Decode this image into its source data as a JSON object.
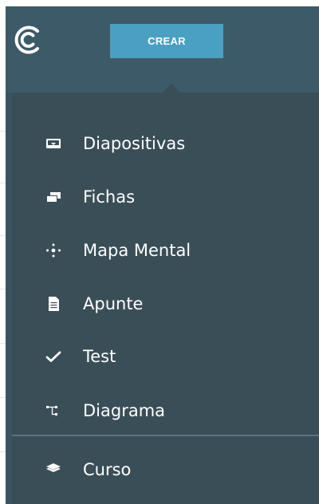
{
  "topbar": {
    "logo_icon": "app-logo-icon",
    "create_button": "CREAR",
    "accent_color": "#4aa0c0"
  },
  "menu": {
    "items": [
      {
        "label": "Diapositivas",
        "icon": "slides-icon"
      },
      {
        "label": "Fichas",
        "icon": "flashcards-icon"
      },
      {
        "label": "Mapa Mental",
        "icon": "mind-map-icon"
      },
      {
        "label": "Apunte",
        "icon": "note-icon"
      },
      {
        "label": "Test",
        "icon": "checkmark-icon"
      },
      {
        "label": "Diagrama",
        "icon": "diagram-icon"
      }
    ],
    "secondary_items": [
      {
        "label": "Curso",
        "icon": "layers-icon"
      }
    ]
  }
}
